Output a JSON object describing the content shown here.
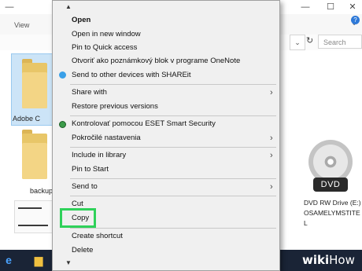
{
  "ribbon": {
    "view_tab": "View"
  },
  "search": {
    "placeholder": "Search This..."
  },
  "files": [
    {
      "label": "Adobe C"
    },
    {
      "label": "backup"
    }
  ],
  "dvd": {
    "badge": "DVD",
    "label": "DVD RW Drive (E:) OSAMELYMSTITE L"
  },
  "context_menu": {
    "items": [
      {
        "label": "Open",
        "bold": true
      },
      {
        "label": "Open in new window"
      },
      {
        "label": "Pin to Quick access"
      },
      {
        "label": "Otvoriť ako poznámkový blok v programe OneNote"
      },
      {
        "label": "Send to other devices with SHAREit",
        "icon": "shareit-icon"
      },
      {
        "label": "Share with",
        "submenu": true
      },
      {
        "label": "Restore previous versions"
      },
      {
        "label": "Kontrolovať pomocou ESET Smart Security",
        "icon": "eset-icon"
      },
      {
        "label": "Pokročilé nastavenia",
        "submenu": true
      },
      {
        "label": "Include in library",
        "submenu": true
      },
      {
        "label": "Pin to Start"
      },
      {
        "label": "Send to",
        "submenu": true
      },
      {
        "label": "Cut"
      },
      {
        "label": "Copy",
        "highlighted": true
      },
      {
        "label": "Create shortcut"
      },
      {
        "label": "Delete"
      }
    ]
  },
  "colors": {
    "highlight": "#2fd15a",
    "taskbar": "#1a2436",
    "selection": "#cce4f7"
  },
  "watermark": {
    "wiki": "wiki",
    "how": "How"
  }
}
